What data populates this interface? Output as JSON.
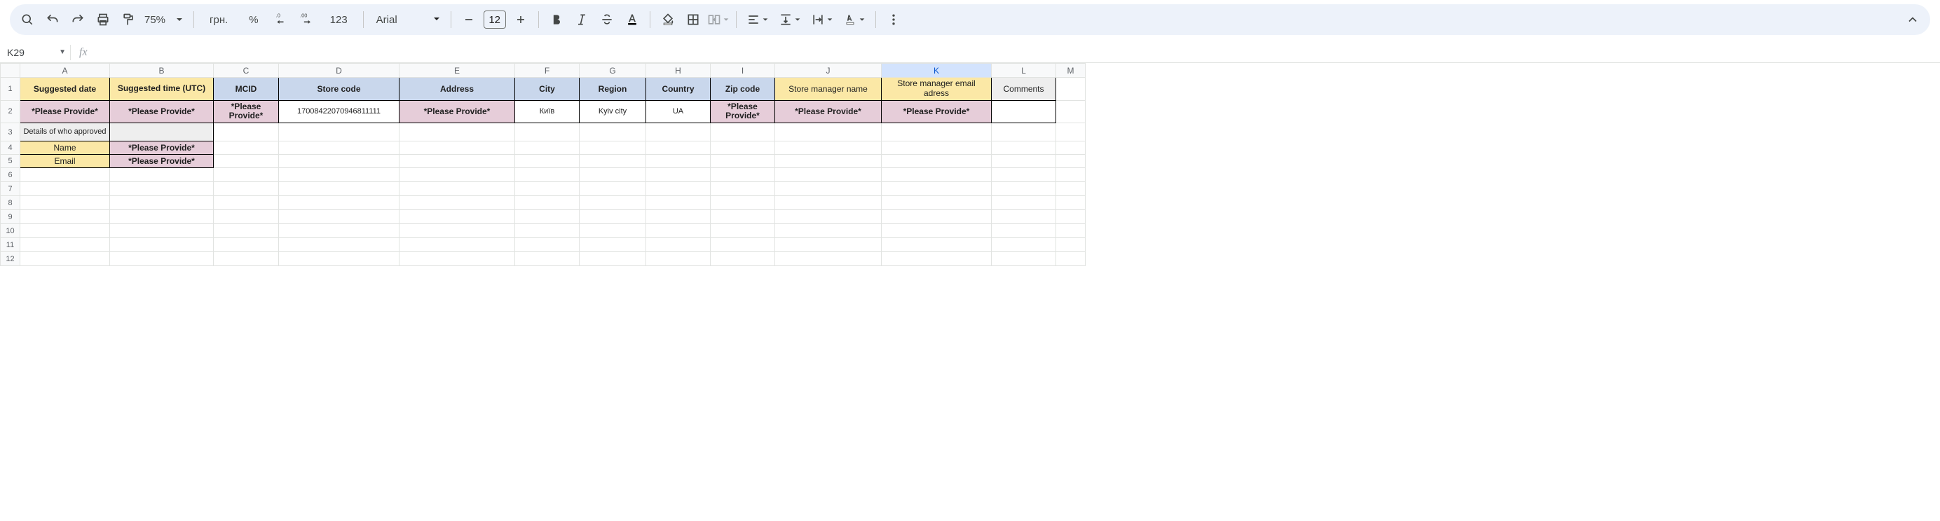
{
  "toolbar": {
    "zoom": "75%",
    "currency": "грн.",
    "percent": "%",
    "format123": "123",
    "font_name": "Arial",
    "font_size": "12"
  },
  "namebox": {
    "ref": "K29"
  },
  "columns": [
    "A",
    "B",
    "C",
    "D",
    "E",
    "F",
    "G",
    "H",
    "I",
    "J",
    "K",
    "L",
    "M"
  ],
  "active_col": "K",
  "row_headers": [
    "1",
    "2",
    "3",
    "4",
    "5",
    "6",
    "7",
    "8",
    "9",
    "10",
    "11",
    "12"
  ],
  "headers": {
    "A": "Suggested date",
    "B": "Suggested time (UTC)",
    "C": "MCID",
    "D": "Store code",
    "E": "Address",
    "F": "City",
    "G": "Region",
    "H": "Country",
    "I": "Zip code",
    "J": "Store manager name",
    "K": "Store manager email adress",
    "L": "Comments"
  },
  "row2": {
    "A": "*Please Provide*",
    "B": "*Please Provide*",
    "C": "*Please Provide*",
    "D": "17008422070946811111",
    "E": "*Please Provide*",
    "F": "Київ",
    "G": "Kyiv city",
    "H": "UA",
    "I": "*Please Provide*",
    "J": "*Please Provide*",
    "K": "*Please Provide*"
  },
  "row3": {
    "A": "Details of who approved"
  },
  "row4": {
    "A": "Name",
    "B": "*Please Provide*"
  },
  "row5": {
    "A": "Email",
    "B": "*Please Provide*"
  },
  "formula_value": ""
}
